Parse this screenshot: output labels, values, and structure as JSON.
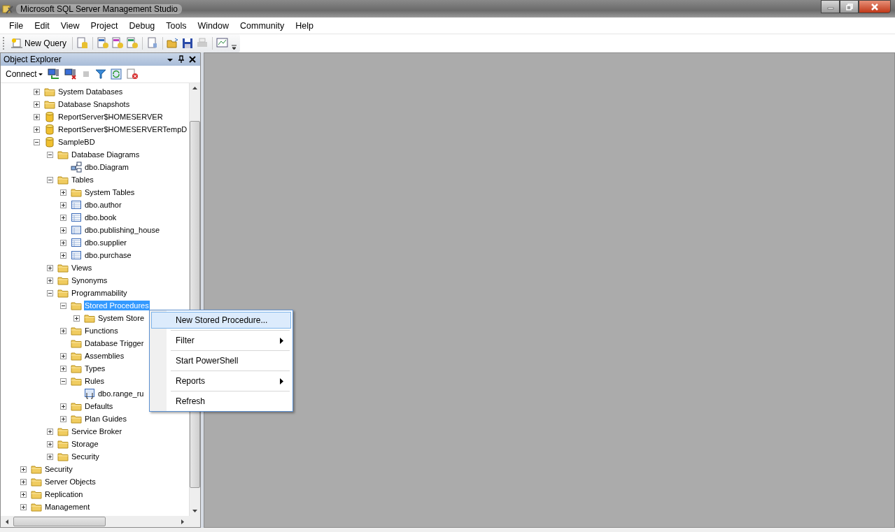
{
  "window": {
    "title": "Microsoft SQL Server Management Studio"
  },
  "menu_bar": [
    "File",
    "Edit",
    "View",
    "Project",
    "Debug",
    "Tools",
    "Window",
    "Community",
    "Help"
  ],
  "toolbar": {
    "new_query": "New Query"
  },
  "object_explorer": {
    "title": "Object Explorer",
    "connect": "Connect",
    "tree": [
      {
        "children": [
          {
            "label": "System Databases",
            "kind": "folder",
            "expanded": false,
            "selected": false
          },
          {
            "label": "Database Snapshots",
            "kind": "folder",
            "expanded": false,
            "selected": false
          },
          {
            "label": "ReportServer$HOMESERVER",
            "kind": "database",
            "expanded": false,
            "selected": false
          },
          {
            "label": "ReportServer$HOMESERVERTempD",
            "kind": "database",
            "expanded": false,
            "selected": false
          },
          {
            "label": "SampleBD",
            "kind": "database",
            "expanded": true,
            "selected": false,
            "children": [
              {
                "label": "Database Diagrams",
                "kind": "folder",
                "expanded": true,
                "selected": false,
                "children": [
                  {
                    "label": "dbo.Diagram",
                    "kind": "diagram",
                    "selected": false
                  }
                ]
              },
              {
                "label": "Tables",
                "kind": "folder",
                "expanded": true,
                "selected": false,
                "children": [
                  {
                    "label": "System Tables",
                    "kind": "folder",
                    "expanded": false,
                    "selected": false
                  },
                  {
                    "label": "dbo.author",
                    "kind": "table",
                    "expanded": false,
                    "selected": false
                  },
                  {
                    "label": "dbo.book",
                    "kind": "table",
                    "expanded": false,
                    "selected": false
                  },
                  {
                    "label": "dbo.publishing_house",
                    "kind": "table",
                    "expanded": false,
                    "selected": false
                  },
                  {
                    "label": "dbo.supplier",
                    "kind": "table",
                    "expanded": false,
                    "selected": false
                  },
                  {
                    "label": "dbo.purchase",
                    "kind": "table",
                    "expanded": false,
                    "selected": false
                  }
                ]
              },
              {
                "label": "Views",
                "kind": "folder",
                "expanded": false,
                "selected": false
              },
              {
                "label": "Synonyms",
                "kind": "folder",
                "expanded": false,
                "selected": false
              },
              {
                "label": "Programmability",
                "kind": "folder",
                "expanded": true,
                "selected": false,
                "children": [
                  {
                    "label": "Stored Procedures",
                    "kind": "folder",
                    "expanded": true,
                    "selected": true,
                    "children": [
                      {
                        "label": "System Store",
                        "kind": "folder",
                        "expanded": false,
                        "selected": false
                      }
                    ]
                  },
                  {
                    "label": "Functions",
                    "kind": "folder",
                    "expanded": false,
                    "selected": false
                  },
                  {
                    "label": "Database Trigger",
                    "kind": "folder",
                    "selected": false
                  },
                  {
                    "label": "Assemblies",
                    "kind": "folder",
                    "expanded": false,
                    "selected": false
                  },
                  {
                    "label": "Types",
                    "kind": "folder",
                    "expanded": false,
                    "selected": false
                  },
                  {
                    "label": "Rules",
                    "kind": "folder",
                    "expanded": true,
                    "selected": false,
                    "children": [
                      {
                        "label": "dbo.range_ru",
                        "kind": "rule",
                        "selected": false
                      }
                    ]
                  },
                  {
                    "label": "Defaults",
                    "kind": "folder",
                    "expanded": false,
                    "selected": false
                  },
                  {
                    "label": "Plan Guides",
                    "kind": "folder",
                    "expanded": false,
                    "selected": false
                  }
                ]
              },
              {
                "label": "Service Broker",
                "kind": "folder",
                "expanded": false,
                "selected": false
              },
              {
                "label": "Storage",
                "kind": "folder",
                "expanded": false,
                "selected": false
              },
              {
                "label": "Security",
                "kind": "folder",
                "expanded": false,
                "selected": false
              }
            ]
          }
        ]
      },
      {
        "label": "Security",
        "kind": "folder",
        "expanded": false,
        "selected": false
      },
      {
        "label": "Server Objects",
        "kind": "folder",
        "expanded": false,
        "selected": false
      },
      {
        "label": "Replication",
        "kind": "folder",
        "expanded": false,
        "selected": false
      },
      {
        "label": "Management",
        "kind": "folder",
        "expanded": false,
        "selected": false
      }
    ]
  },
  "context_menu": [
    {
      "label": "New Stored Procedure...",
      "selected": true,
      "submenu": false
    },
    {
      "label": "Filter",
      "selected": false,
      "submenu": true
    },
    {
      "label": "Start PowerShell",
      "selected": false,
      "submenu": false
    },
    {
      "label": "Reports",
      "selected": false,
      "submenu": true
    },
    {
      "label": "Refresh",
      "selected": false,
      "submenu": false
    }
  ]
}
